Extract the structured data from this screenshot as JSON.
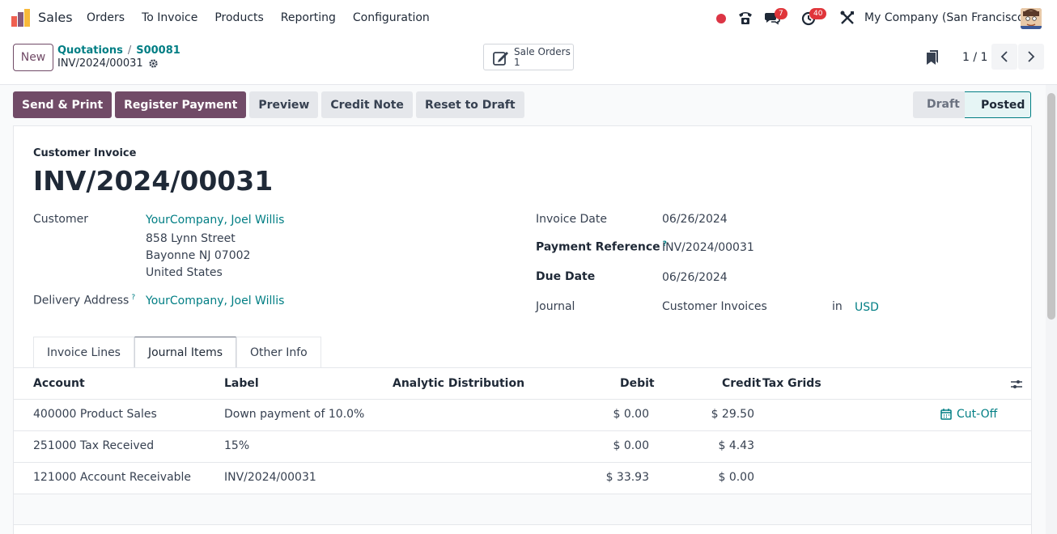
{
  "navbar": {
    "app_name": "Sales",
    "menu": [
      "Orders",
      "To Invoice",
      "Products",
      "Reporting",
      "Configuration"
    ],
    "messages_count": "7",
    "activities_count": "40",
    "company": "My Company (San Francisco)"
  },
  "control": {
    "new_label": "New",
    "breadcrumb": [
      "Quotations",
      "S00081"
    ],
    "record_name": "INV/2024/00031",
    "smart_button": {
      "label": "Sale Orders",
      "count": "1"
    },
    "pager": "1 / 1"
  },
  "actions": {
    "send_print": "Send & Print",
    "register_payment": "Register Payment",
    "preview": "Preview",
    "credit_note": "Credit Note",
    "reset_draft": "Reset to Draft"
  },
  "status": {
    "draft": "Draft",
    "posted": "Posted",
    "current": "Posted"
  },
  "invoice": {
    "subtitle": "Customer Invoice",
    "number": "INV/2024/00031",
    "customer_label": "Customer",
    "customer": "YourCompany, Joel Willis",
    "address_line1": "858 Lynn Street",
    "address_line2": "Bayonne NJ 07002",
    "address_line3": "United States",
    "delivery_label": "Delivery Address",
    "delivery": "YourCompany, Joel Willis",
    "invoice_date_label": "Invoice Date",
    "invoice_date": "06/26/2024",
    "payment_ref_label": "Payment Reference",
    "payment_ref": "INV/2024/00031",
    "due_date_label": "Due Date",
    "due_date": "06/26/2024",
    "journal_label": "Journal",
    "journal": "Customer Invoices",
    "journal_in": "in",
    "currency": "USD",
    "help_mark": "?"
  },
  "tabs": [
    "Invoice Lines",
    "Journal Items",
    "Other Info"
  ],
  "table": {
    "headers": {
      "account": "Account",
      "label": "Label",
      "analytic": "Analytic Distribution",
      "debit": "Debit",
      "credit": "Credit",
      "tax": "Tax Grids"
    },
    "rows": [
      {
        "account": "400000 Product Sales",
        "label": "Down payment of 10.0%",
        "debit": "$ 0.00",
        "credit": "$ 29.50",
        "cutoff": "Cut-Off"
      },
      {
        "account": "251000 Tax Received",
        "label": "15%",
        "debit": "$ 0.00",
        "credit": "$ 4.43"
      },
      {
        "account": "121000 Account Receivable",
        "label": "INV/2024/00031",
        "debit": "$ 33.93",
        "credit": "$ 0.00"
      }
    ]
  },
  "colors": {
    "brand": "#714b67",
    "link": "#017e84",
    "danger": "#dc3545"
  }
}
